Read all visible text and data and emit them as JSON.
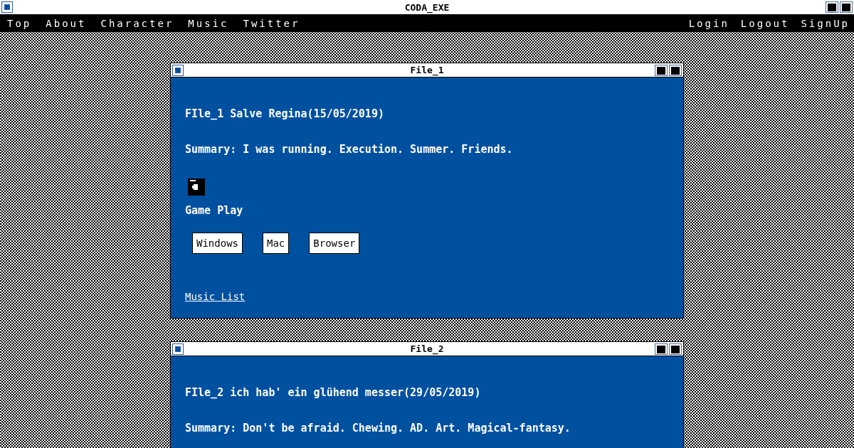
{
  "window": {
    "title": "CODA_EXE"
  },
  "nav": {
    "left": [
      "Top",
      "About",
      "Character",
      "Music",
      "Twitter"
    ],
    "right": [
      "Login",
      "Logout",
      "SignUp"
    ]
  },
  "files": [
    {
      "title": "File_1",
      "heading": "FIle_1 Salve Regina(15/05/2019)",
      "summary": "Summary: I was running. Execution. Summer. Friends.",
      "game": {
        "label": "Game Play",
        "buttons": [
          "Windows",
          "Mac",
          "Browser"
        ]
      },
      "link": "Music List"
    },
    {
      "title": "File_2",
      "heading": "FIle_2 ich hab' ein glühend messer(29/05/2019)",
      "summary": "Summary: Don't be afraid. Chewing. AD. Art. Magical-fantasy."
    }
  ]
}
